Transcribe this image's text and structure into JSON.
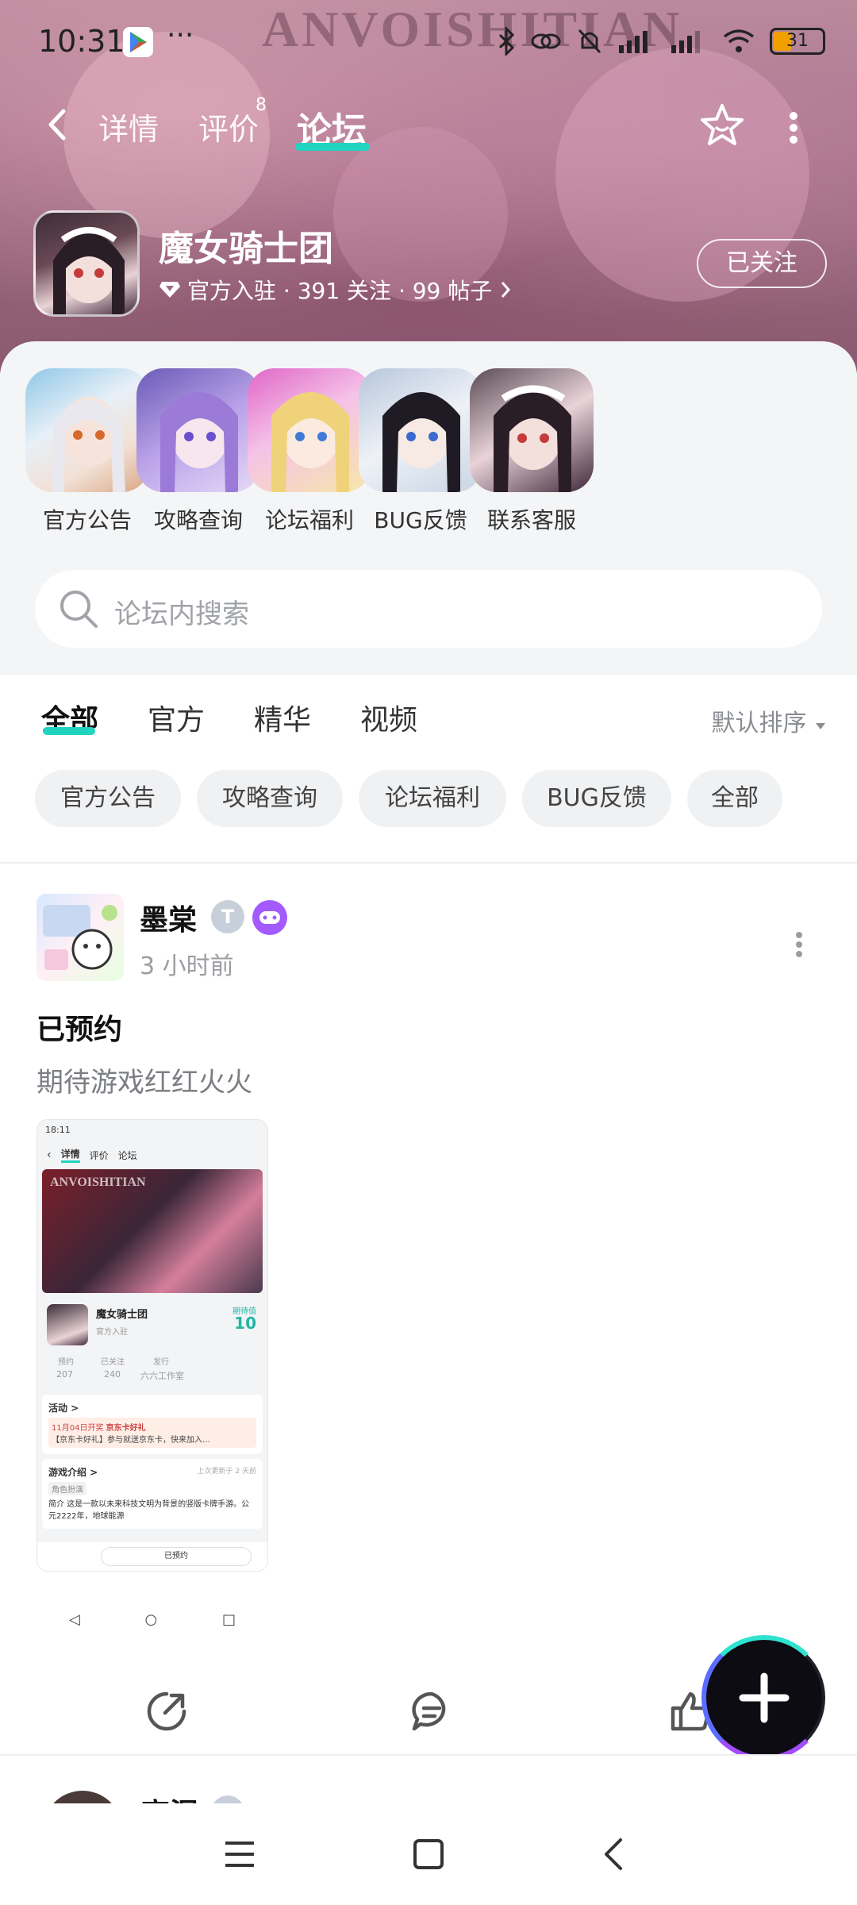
{
  "status_bar": {
    "time": "10:31",
    "battery": "31"
  },
  "nav": {
    "tabs": [
      {
        "label": "详情"
      },
      {
        "label": "评价",
        "badge": "8"
      },
      {
        "label": "论坛"
      }
    ],
    "active_tab": "论坛"
  },
  "banner_text": "ANVOISHITIAN",
  "game": {
    "name": "魔女骑士团",
    "meta": "官方入驻 · 391 关注 · 99 帖子",
    "follow_label": "已关注"
  },
  "shortcuts": [
    {
      "label": "官方公告"
    },
    {
      "label": "攻略查询"
    },
    {
      "label": "论坛福利"
    },
    {
      "label": "BUG反馈"
    },
    {
      "label": "联系客服"
    }
  ],
  "search": {
    "placeholder": "论坛内搜索"
  },
  "filter_tabs": [
    {
      "label": "全部"
    },
    {
      "label": "官方"
    },
    {
      "label": "精华"
    },
    {
      "label": "视频"
    }
  ],
  "sort_label": "默认排序",
  "chips": [
    {
      "label": "官方公告"
    },
    {
      "label": "攻略查询"
    },
    {
      "label": "论坛福利"
    },
    {
      "label": "BUG反馈"
    },
    {
      "label": "全部"
    }
  ],
  "post": {
    "author": "墨棠",
    "badge_letter": "T",
    "time": "3 小时前",
    "title": "已预约",
    "body": "期待游戏红红火火",
    "screenshot": {
      "time": "18:11",
      "tabs": [
        "详情",
        "评价",
        "论坛"
      ],
      "banner_text": "ANVOISHITIAN",
      "game_name": "魔女骑士团",
      "game_sub": "官方入驻",
      "score_label": "期待值",
      "score": "10",
      "stats": [
        "预约",
        "已关注",
        "发行",
        "207",
        "240",
        "六六工作室"
      ],
      "activity_title": "活动 >",
      "activity_tag": "11月04日开奖",
      "activity_name": "京东卡好礼",
      "activity_desc": "【京东卡好礼】参与就送京东卡，快来加入…",
      "intro_title": "游戏介绍 >",
      "intro_updated": "上次更新于 2 天前",
      "intro_tag": "角色扮演",
      "intro_text": "简介 这是一款以未来科技文明为背景的竖版卡牌手游。公元2222年，地球能源",
      "reserve_label": "已预约"
    }
  },
  "next_post": {
    "author": "高涅"
  }
}
